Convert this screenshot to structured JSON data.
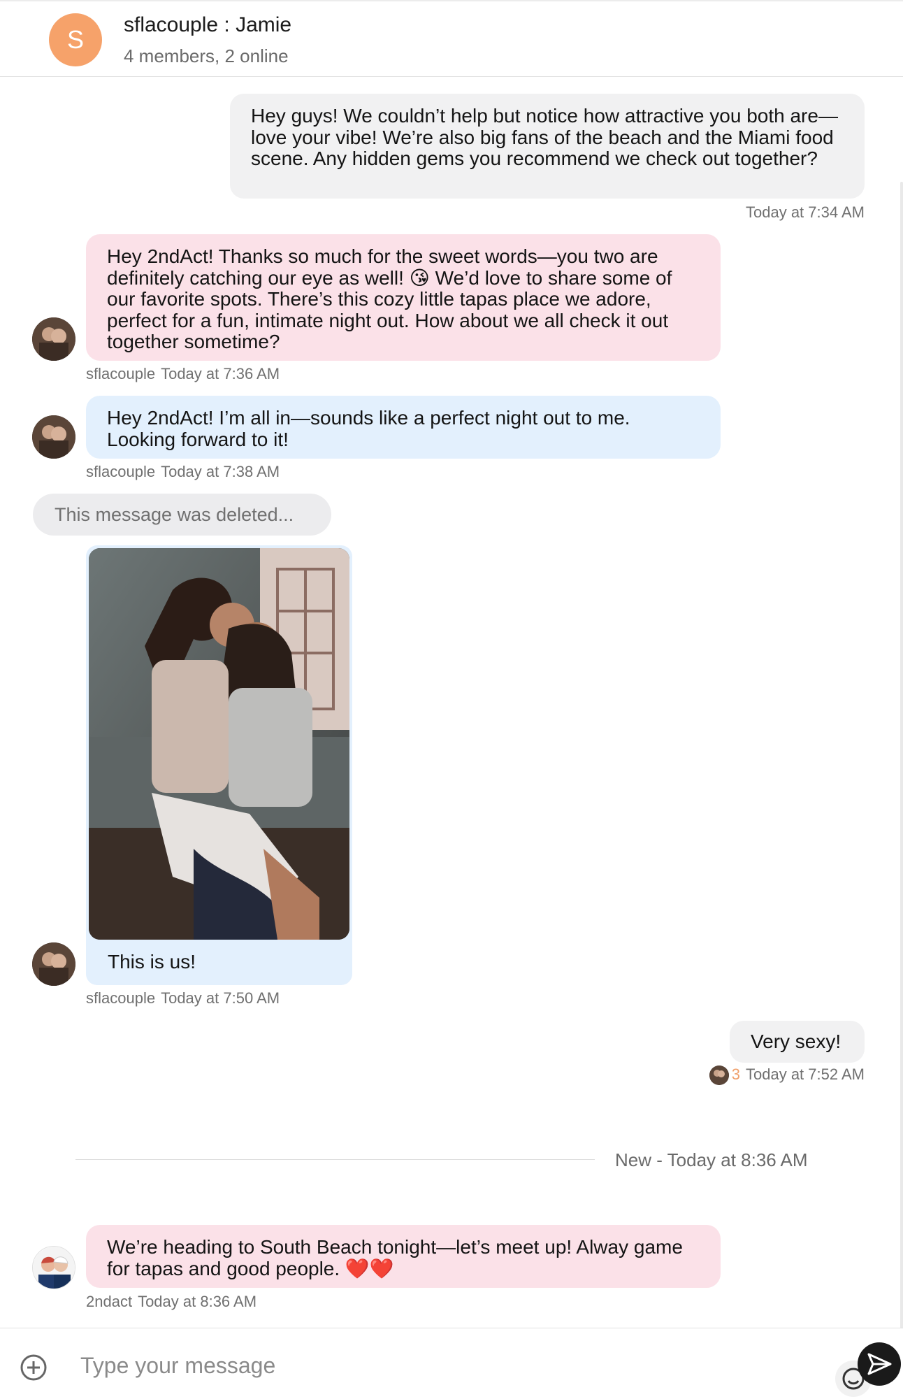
{
  "header": {
    "avatar_letter": "S",
    "title": "sflacouple : Jamie",
    "subtitle": "4 members, 2 online"
  },
  "messages": [
    {
      "text": "Hey guys! We couldn’t help but notice how attractive you both are—love your vibe! We’re also big fans of the beach and the Miami food scene. Any hidden gems you recommend we check out together?",
      "time": "Today at 7:34 AM"
    },
    {
      "text": "Hey 2ndAct! Thanks so much for the sweet words—you two are definitely catching our eye as well! 😘 We’d love to share some of our favorite spots. There’s this cozy little tapas place we adore, perfect for a fun, intimate night out. How about we all check it out together sometime?",
      "sender": "sflacouple",
      "time": "Today at 7:36 AM"
    },
    {
      "text": "Hey 2ndAct! I’m all in—sounds like a perfect night out to me. Looking forward to it!",
      "sender": "sflacouple",
      "time": "Today at 7:38 AM"
    },
    {
      "text": "This message was deleted..."
    },
    {
      "caption": "This is us!",
      "sender": "sflacouple",
      "time": "Today at 7:50 AM"
    },
    {
      "text": "Very sexy!",
      "read_count": "3",
      "time": "Today at 7:52 AM"
    },
    {
      "text": "We’re heading to South Beach tonight—let’s meet up! Alway game for tapas and good people. ❤️❤️",
      "sender": "2ndact",
      "time": "Today at 8:36 AM"
    }
  ],
  "divider": {
    "label": "New - Today at 8:36 AM"
  },
  "composer": {
    "placeholder": "Type your message"
  },
  "colors": {
    "accent_orange": "#f6a26a",
    "bubble_pink": "#fbe1e8",
    "bubble_blue": "#e3f0fd",
    "bubble_gray": "#f1f1f2"
  },
  "icons": [
    "add-icon",
    "emoji-icon",
    "send-icon"
  ]
}
